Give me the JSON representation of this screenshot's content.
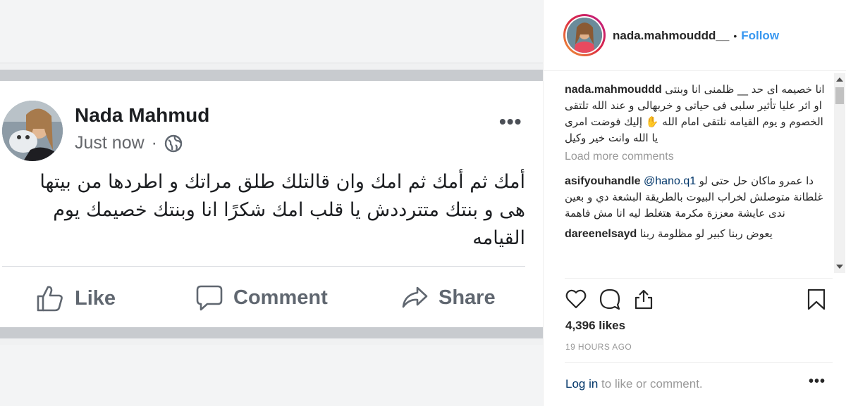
{
  "facebook_post": {
    "author": "Nada Mahmud",
    "timestamp": "Just now",
    "separator": "·",
    "privacy_icon": "globe-icon",
    "more_label": "•••",
    "text": "أمك ثم أمك ثم امك وان قالتلك طلق مراتك و  اطردها من بيتها هى و بنتك متترددش يا قلب امك  شكرًا انا وبنتك خصيمك يوم القيامه",
    "actions": {
      "like_label": "Like",
      "comment_label": "Comment",
      "share_label": "Share"
    }
  },
  "instagram": {
    "header": {
      "username": "nada.mahmouddd__",
      "dot": "•",
      "follow_label": "Follow"
    },
    "comments": [
      {
        "user": "nada.mahmouddd",
        "text": "انا خصيمه اى حد __ ظلمنى انا وبنتى او اثر عليا تأثير سلبى فى حياتى و خربهالى و عند الله تلتقى الخصوم و يوم القيامه نلتقى امام الله ✋ إليك فوضت امرى يا الله وانت خير وكيل"
      },
      {
        "user": "asifyouhandle",
        "mention": "@hano.q1",
        "text": "دا عمرو ماكان حل حتى لو غلطانة متوصلش لخراب البيوت بالطريقة البشعة دي و بعين ندى عايشة معززة مكرمة هتغلط ليه انا مش فاهمة"
      },
      {
        "user": "dareenelsayd",
        "text": "يعوض ربنا كبير لو مظلومة ربنا"
      }
    ],
    "load_more_label": "Load more comments",
    "likes": "4,396 likes",
    "time_ago": "19 HOURS AGO",
    "login_link": "Log in",
    "login_rest": " to like or comment.",
    "more_label": "•••"
  }
}
